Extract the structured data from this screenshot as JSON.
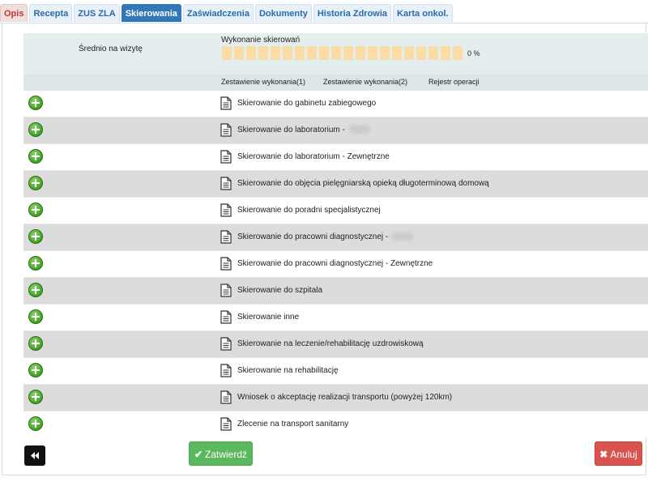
{
  "tabs": [
    {
      "label": "Opis"
    },
    {
      "label": "Recepta"
    },
    {
      "label": "ZUS ZLA"
    },
    {
      "label": "Skierowania"
    },
    {
      "label": "Zaświadczenia"
    },
    {
      "label": "Dokumenty"
    },
    {
      "label": "Historia Zdrowia"
    },
    {
      "label": "Karta onkol."
    }
  ],
  "active_tab": "Skierowania",
  "summary": {
    "avg_label": "Średnio na wizytę",
    "exec_label": "Wykonanie skierowań",
    "progress_percent_text": "0 %",
    "progress_value": 0,
    "links": [
      "Zestawienie wykonania(1)",
      "Zestawienie wykonania(2)",
      "Rejestr operacji"
    ]
  },
  "referrals": [
    {
      "label": "Skierowanie do gabinetu zabiegowego",
      "redacted": false
    },
    {
      "label": "Skierowanie do laboratorium - ",
      "redacted": true
    },
    {
      "label": "Skierowanie do laboratorium - Zewnętrzne",
      "redacted": false
    },
    {
      "label": "Skierowanie do objęcia pielęgniarską opieką długoterminową domową",
      "redacted": false
    },
    {
      "label": "Skierowanie do poradni specjalistycznej",
      "redacted": false
    },
    {
      "label": "Skierowanie do pracowni diagnostycznej - ",
      "redacted": true
    },
    {
      "label": "Skierowanie do pracowni diagnostycznej - Zewnętrzne",
      "redacted": false
    },
    {
      "label": "Skierowanie do szpitala",
      "redacted": false
    },
    {
      "label": "Skierowanie inne",
      "redacted": false
    },
    {
      "label": "Skierowanie na leczenie/rehabilitację uzdrowiskową",
      "redacted": false
    },
    {
      "label": "Skierowanie na rehabilitację",
      "redacted": false
    },
    {
      "label": "Wniosek o akceptację realizacji transportu (powyżej 120km)",
      "redacted": false
    },
    {
      "label": "Zlecenie na transport sanitarny",
      "redacted": false
    }
  ],
  "footer": {
    "confirm_label": "Zatwierdź",
    "cancel_label": "Anuluj"
  },
  "icons": {
    "back": "double-chevron-left-icon",
    "add": "green-plus-circle-icon",
    "doc": "document-icon",
    "confirm": "check-icon",
    "cancel": "x-icon"
  },
  "colors": {
    "active_tab": "#3278b8",
    "confirm": "#5cb85c",
    "cancel": "#d9534f",
    "progress_empty": "#fbdca4"
  }
}
